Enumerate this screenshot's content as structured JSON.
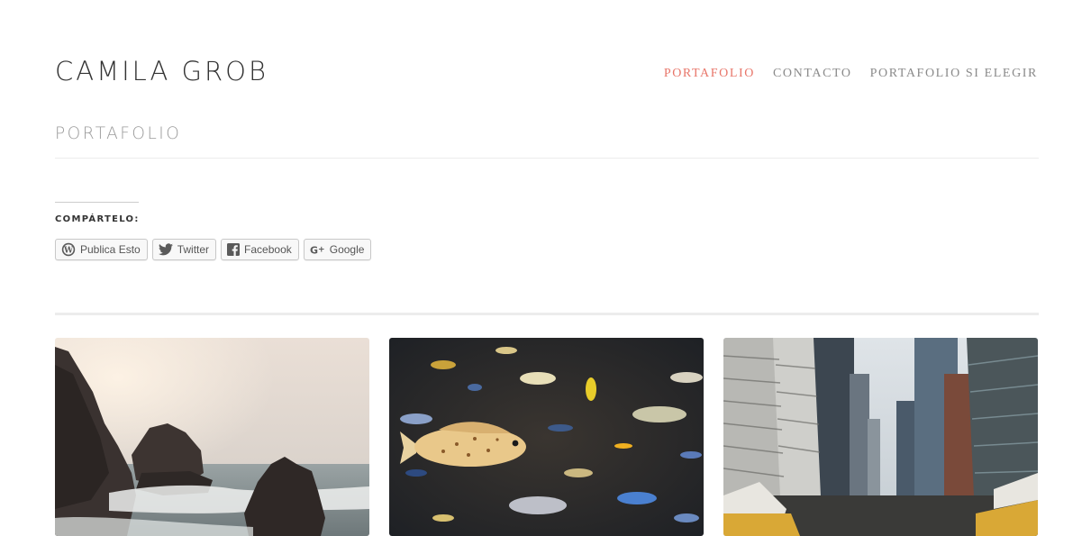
{
  "site": {
    "title": "CAMILA GROB"
  },
  "nav": {
    "items": [
      {
        "label": "PORTAFOLIO",
        "active": true
      },
      {
        "label": "CONTACTO",
        "active": false
      },
      {
        "label": "PORTAFOLIO SI ELEGIR",
        "active": false
      }
    ]
  },
  "page": {
    "title": "PORTAFOLIO"
  },
  "share": {
    "heading": "COMPÁRTELO:",
    "buttons": [
      {
        "label": "Publica Esto",
        "icon": "wordpress-icon"
      },
      {
        "label": "Twitter",
        "icon": "twitter-icon"
      },
      {
        "label": "Facebook",
        "icon": "facebook-icon"
      },
      {
        "label": "Google",
        "icon": "google-plus-icon"
      }
    ]
  },
  "gallery": {
    "items": [
      {
        "subject": "rocky-coast"
      },
      {
        "subject": "aquarium-fish"
      },
      {
        "subject": "city-street"
      }
    ]
  },
  "colors": {
    "accent": "#e8766a",
    "nav_text": "#8a8a8a",
    "title_text": "#333333"
  }
}
